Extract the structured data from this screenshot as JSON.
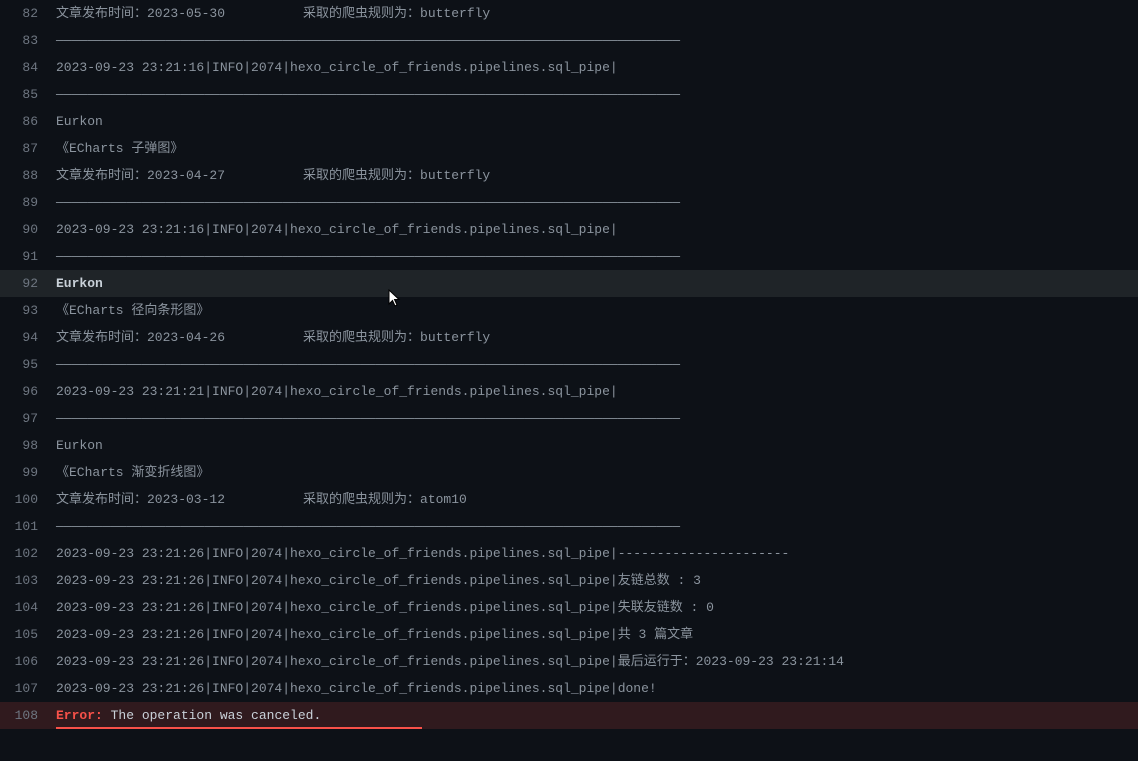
{
  "lines": [
    {
      "num": "82",
      "content": "文章发布时间：2023-05-30          采取的爬虫规则为：butterfly",
      "highlighted": false
    },
    {
      "num": "83",
      "content": "————————————————————————————————————————————————————————————————————————————————",
      "highlighted": false
    },
    {
      "num": "84",
      "content": "2023-09-23 23:21:16|INFO|2074|hexo_circle_of_friends.pipelines.sql_pipe|",
      "highlighted": false
    },
    {
      "num": "85",
      "content": "————————————————————————————————————————————————————————————————————————————————",
      "highlighted": false
    },
    {
      "num": "86",
      "content": "Eurkon",
      "highlighted": false
    },
    {
      "num": "87",
      "content": "《ECharts 子弹图》",
      "highlighted": false
    },
    {
      "num": "88",
      "content": "文章发布时间：2023-04-27          采取的爬虫规则为：butterfly",
      "highlighted": false
    },
    {
      "num": "89",
      "content": "————————————————————————————————————————————————————————————————————————————————",
      "highlighted": false
    },
    {
      "num": "90",
      "content": "2023-09-23 23:21:16|INFO|2074|hexo_circle_of_friends.pipelines.sql_pipe|",
      "highlighted": false
    },
    {
      "num": "91",
      "content": "————————————————————————————————————————————————————————————————————————————————",
      "highlighted": false
    },
    {
      "num": "92",
      "content": "Eurkon",
      "highlighted": true
    },
    {
      "num": "93",
      "content": "《ECharts 径向条形图》",
      "highlighted": false
    },
    {
      "num": "94",
      "content": "文章发布时间：2023-04-26          采取的爬虫规则为：butterfly",
      "highlighted": false
    },
    {
      "num": "95",
      "content": "————————————————————————————————————————————————————————————————————————————————",
      "highlighted": false
    },
    {
      "num": "96",
      "content": "2023-09-23 23:21:21|INFO|2074|hexo_circle_of_friends.pipelines.sql_pipe|",
      "highlighted": false
    },
    {
      "num": "97",
      "content": "————————————————————————————————————————————————————————————————————————————————",
      "highlighted": false
    },
    {
      "num": "98",
      "content": "Eurkon",
      "highlighted": false
    },
    {
      "num": "99",
      "content": "《ECharts 渐变折线图》",
      "highlighted": false
    },
    {
      "num": "100",
      "content": "文章发布时间：2023-03-12          采取的爬虫规则为：atom10",
      "highlighted": false
    },
    {
      "num": "101",
      "content": "————————————————————————————————————————————————————————————————————————————————",
      "highlighted": false
    },
    {
      "num": "102",
      "content": "2023-09-23 23:21:26|INFO|2074|hexo_circle_of_friends.pipelines.sql_pipe|----------------------",
      "highlighted": false
    },
    {
      "num": "103",
      "content": "2023-09-23 23:21:26|INFO|2074|hexo_circle_of_friends.pipelines.sql_pipe|友链总数 : 3",
      "highlighted": false
    },
    {
      "num": "104",
      "content": "2023-09-23 23:21:26|INFO|2074|hexo_circle_of_friends.pipelines.sql_pipe|失联友链数 : 0",
      "highlighted": false
    },
    {
      "num": "105",
      "content": "2023-09-23 23:21:26|INFO|2074|hexo_circle_of_friends.pipelines.sql_pipe|共 3 篇文章",
      "highlighted": false
    },
    {
      "num": "106",
      "content": "2023-09-23 23:21:26|INFO|2074|hexo_circle_of_friends.pipelines.sql_pipe|最后运行于：2023-09-23 23:21:14",
      "highlighted": false
    },
    {
      "num": "107",
      "content": "2023-09-23 23:21:26|INFO|2074|hexo_circle_of_friends.pipelines.sql_pipe|done!",
      "highlighted": false
    }
  ],
  "error": {
    "num": "108",
    "label": "Error:",
    "text": " The operation was canceled."
  }
}
